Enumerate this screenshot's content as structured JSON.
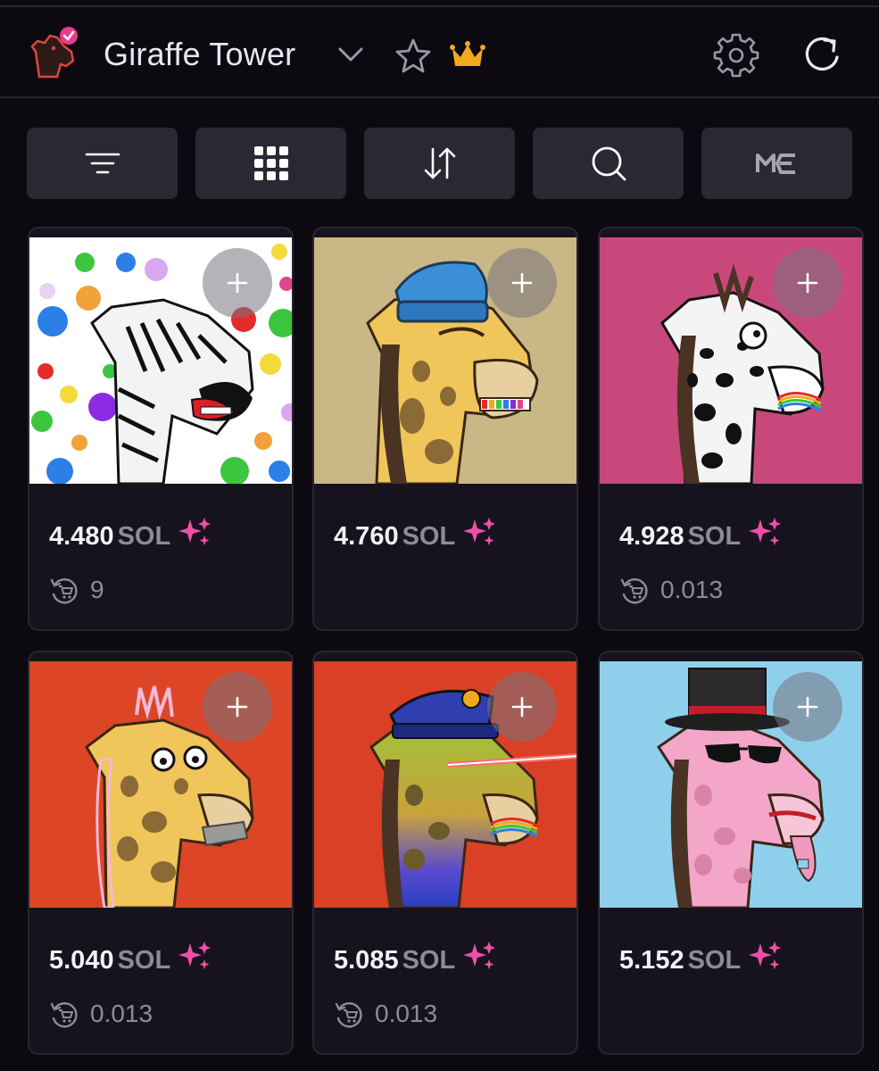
{
  "header": {
    "title": "Giraffe Tower"
  },
  "colors": {
    "accent_pink": "#e83d8f",
    "crown_gold": "#f3a91d",
    "bg": "#0c0911",
    "card_bg": "#17131e",
    "button_bg": "#2b2733"
  },
  "toolbar": {
    "buttons": [
      {
        "icon": "filter-icon"
      },
      {
        "icon": "grid-icon"
      },
      {
        "icon": "sort-icon"
      },
      {
        "icon": "search-icon"
      },
      {
        "icon": "magic-eden-icon"
      }
    ]
  },
  "cards": [
    {
      "price": "4.480",
      "unit": "SOL",
      "fee": "9",
      "bg": "#ffffff",
      "art": "zebra-giraffe"
    },
    {
      "price": "4.760",
      "unit": "SOL",
      "fee": "",
      "bg": "#c9b785",
      "art": "beanie-giraffe"
    },
    {
      "price": "4.928",
      "unit": "SOL",
      "fee": "0.013",
      "bg": "#c9487c",
      "art": "dalmatian-giraffe"
    },
    {
      "price": "5.040",
      "unit": "SOL",
      "fee": "0.013",
      "bg": "#dc4626",
      "art": "taped-mouth-giraffe"
    },
    {
      "price": "5.085",
      "unit": "SOL",
      "fee": "0.013",
      "bg": "#d94026",
      "art": "police-laser-giraffe"
    },
    {
      "price": "5.152",
      "unit": "SOL",
      "fee": "",
      "bg": "#8ed0ec",
      "art": "tophat-giraffe"
    }
  ]
}
